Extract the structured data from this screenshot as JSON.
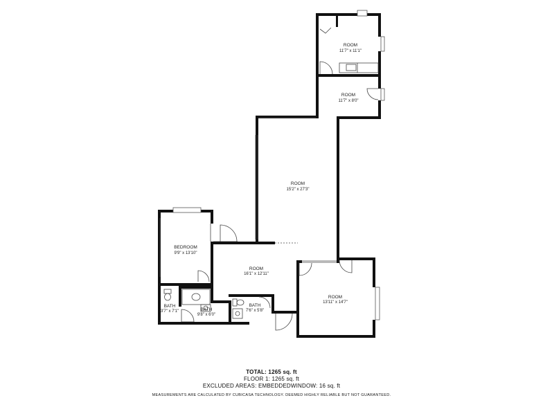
{
  "rooms": [
    {
      "name": "ROOM",
      "dims": "11'7\" x 11'1\""
    },
    {
      "name": "ROOM",
      "dims": "11'7\" x 8'0\""
    },
    {
      "name": "ROOM",
      "dims": "15'2\" x 27'3\""
    },
    {
      "name": "BEDROOM",
      "dims": "9'9\" x 13'10\""
    },
    {
      "name": "ROOM",
      "dims": "16'1\" x 12'11\""
    },
    {
      "name": "ROOM",
      "dims": "13'11\" x 14'7\""
    },
    {
      "name": "BATH",
      "dims": "3'7\" x 7'1\""
    },
    {
      "name": "BATH",
      "dims": "9'8\" x 6'0\""
    },
    {
      "name": "BATH",
      "dims": "7'6\" x 5'8\""
    }
  ],
  "summary": {
    "total": "TOTAL: 1265 sq. ft",
    "floor1": "FLOOR 1: 1265 sq. ft",
    "excluded": "EXCLUDED AREAS: EMBEDDEDWINDOW: 16 sq. ft",
    "disclaimer": "MEASUREMENTS ARE CALCULATED BY CUBICASA TECHNOLOGY. DEEMED HIGHLY RELIABLE BUT NOT GUARANTEED."
  }
}
